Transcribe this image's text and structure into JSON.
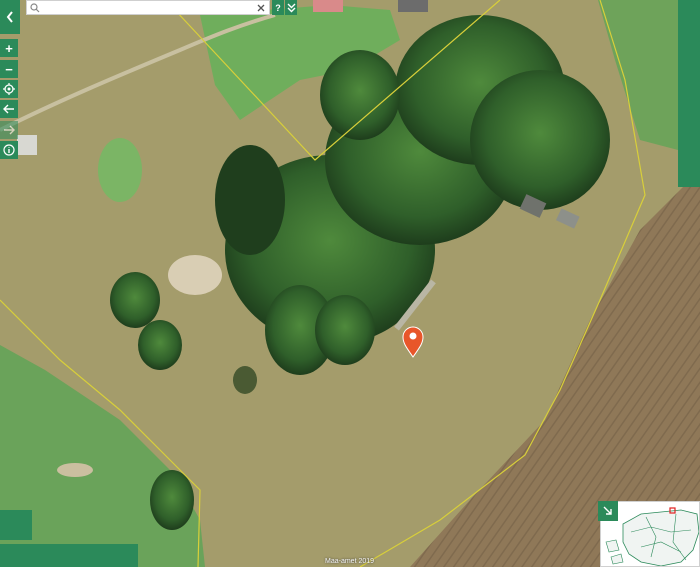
{
  "search": {
    "placeholder": "",
    "value": ""
  },
  "controls": {
    "back": "chevron-left-icon",
    "clear": "close-icon",
    "help": "?",
    "expand": "double-chevron-down-icon",
    "zoom_in": "+",
    "zoom_out": "−",
    "locate": "target-icon",
    "history_back": "arrow-left-icon",
    "history_forward": "arrow-right-icon",
    "info": "info-icon",
    "overview_toggle": "arrow-down-right-icon"
  },
  "attribution": "Maa-amet 2019",
  "colors": {
    "ui_green": "#2b8a5a",
    "parcel_line": "#d8cf3a",
    "marker": "#e8562a",
    "field_dirt": "#8c7557",
    "meadow": "#a8a06a",
    "grass": "#67a355",
    "trees": "#2f5f2a"
  },
  "map": {
    "marker": "map-pin-icon",
    "overview_highlight": "#e02020"
  }
}
